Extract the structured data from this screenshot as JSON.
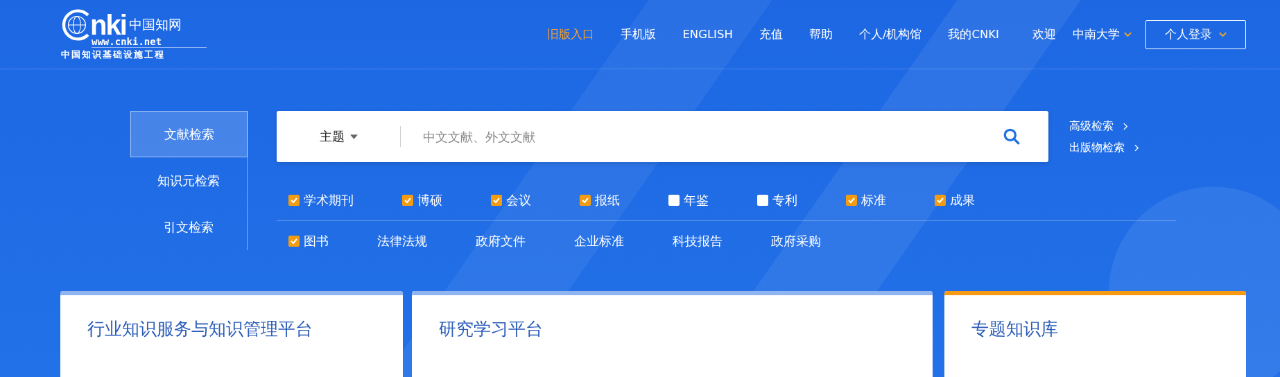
{
  "logo": {
    "brand": "nki",
    "name_cn": "中国知网",
    "url": "www.cnki.net",
    "tagline": "中国知识基础设施工程"
  },
  "nav": [
    {
      "label": "旧版入口",
      "highlighted": true
    },
    {
      "label": "手机版",
      "highlighted": false
    },
    {
      "label": "ENGLISH",
      "highlighted": false
    },
    {
      "label": "充值",
      "highlighted": false
    },
    {
      "label": "帮助",
      "highlighted": false
    },
    {
      "label": "个人/机构馆",
      "highlighted": false
    },
    {
      "label": "我的CNKI",
      "highlighted": false
    }
  ],
  "welcome": "欢迎",
  "institution": "中南大学",
  "login_button": "个人登录",
  "search_tabs": [
    {
      "label": "文献检索",
      "selected": true
    },
    {
      "label": "知识元检索",
      "selected": false
    },
    {
      "label": "引文检索",
      "selected": false
    }
  ],
  "search": {
    "field": "主题",
    "placeholder": "中文文献、外文文献"
  },
  "side_links": [
    "高级检索",
    "出版物检索"
  ],
  "source_rows": [
    [
      {
        "kind": "checkbox",
        "label": "学术期刊",
        "checked": true
      },
      {
        "kind": "checkbox",
        "label": "博硕",
        "checked": true
      },
      {
        "kind": "checkbox",
        "label": "会议",
        "checked": true
      },
      {
        "kind": "checkbox",
        "label": "报纸",
        "checked": true
      },
      {
        "kind": "checkbox",
        "label": "年鉴",
        "checked": false
      },
      {
        "kind": "checkbox",
        "label": "专利",
        "checked": false
      },
      {
        "kind": "checkbox",
        "label": "标准",
        "checked": true
      },
      {
        "kind": "checkbox",
        "label": "成果",
        "checked": true
      }
    ],
    [
      {
        "kind": "checkbox",
        "label": "图书",
        "checked": true
      },
      {
        "kind": "link",
        "label": "法律法规"
      },
      {
        "kind": "link",
        "label": "政府文件"
      },
      {
        "kind": "link",
        "label": "企业标准"
      },
      {
        "kind": "link",
        "label": "科技报告"
      },
      {
        "kind": "link",
        "label": "政府采购"
      }
    ]
  ],
  "cards": [
    {
      "title": "行业知识服务与知识管理平台",
      "color": "#8fb4ef"
    },
    {
      "title": "研究学习平台",
      "color": "#8fb4ef"
    },
    {
      "title": "专题知识库",
      "color": "#f59a12"
    }
  ]
}
